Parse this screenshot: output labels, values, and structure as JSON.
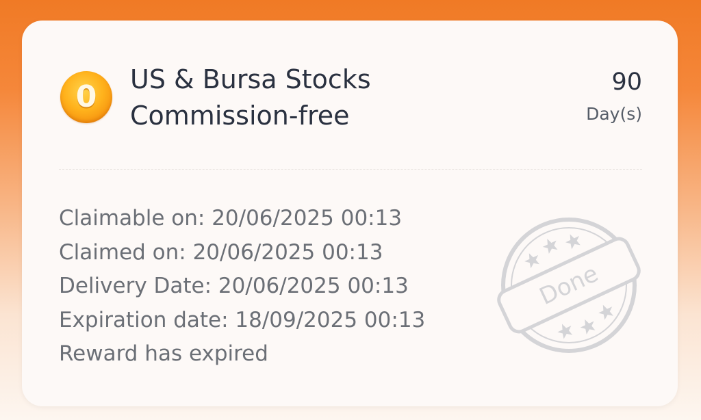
{
  "reward": {
    "badge_glyph": "0",
    "badge_icon": "coin-icon",
    "title_line1": "US & Bursa Stocks",
    "title_line2": "Commission-free",
    "duration_value": "90",
    "duration_unit": "Day(s)"
  },
  "details": {
    "claimable_on": "Claimable on: 20/06/2025 00:13",
    "claimed_on": "Claimed on: 20/06/2025 00:13",
    "delivery_date": "Delivery Date: 20/06/2025 00:13",
    "expiration_date": "Expiration date: 18/09/2025 00:13",
    "status": "Reward has expired"
  },
  "stamp": {
    "label": "Done",
    "icon": "done-stamp-icon"
  },
  "colors": {
    "accent": "#f07a25",
    "coin": "#ffb21c",
    "title_text": "#2a3140",
    "detail_text": "#6b6f76",
    "stamp": "#d3d3d6"
  }
}
